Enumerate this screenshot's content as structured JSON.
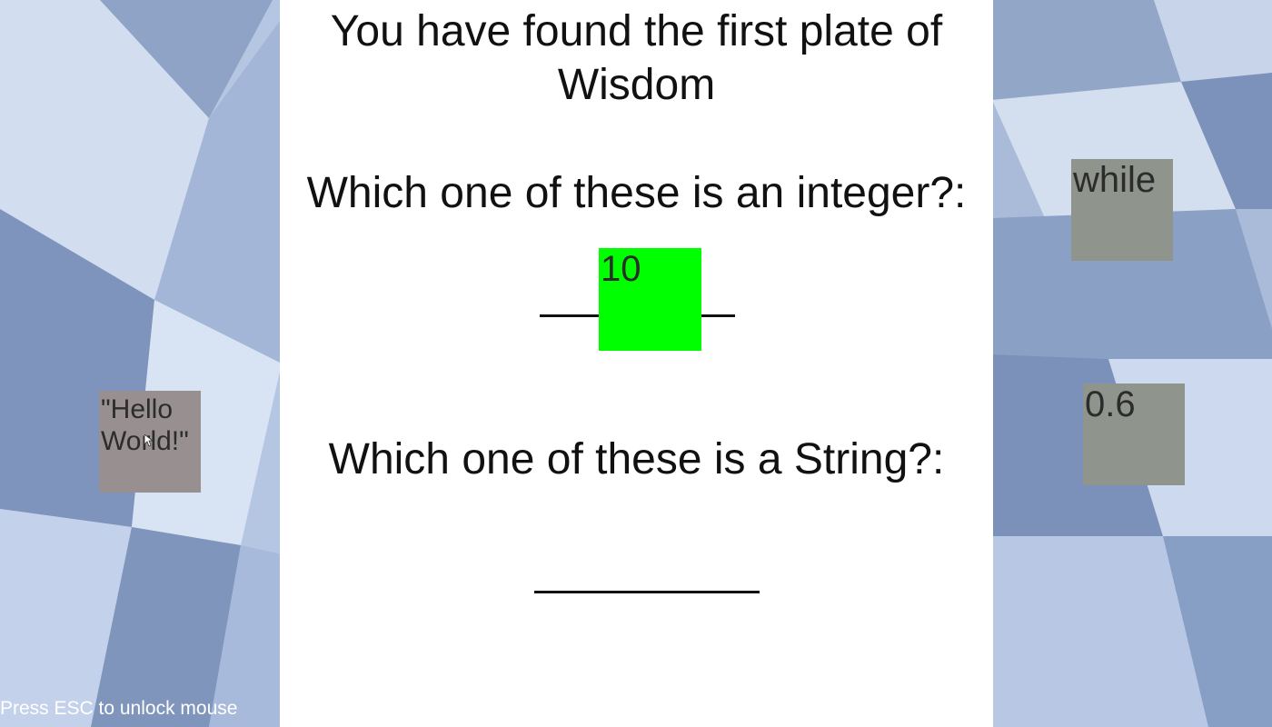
{
  "plate": {
    "title_line1": "You have found the first plate of",
    "title_line2": "Wisdom",
    "question1": "Which one of these is an integer?:",
    "answer1": "10",
    "question2": "Which one of these is a String?:",
    "answer2": ""
  },
  "blocks": {
    "hello": {
      "line1": "\"Hello",
      "line2": "World!\""
    },
    "while": "while",
    "decimal": "0.6"
  },
  "hud": {
    "hint": "Press ESC to unlock mouse"
  },
  "colors": {
    "correct_slot": "#00ff00",
    "panel": "#ffffff",
    "block_grey": "#8f958c"
  }
}
